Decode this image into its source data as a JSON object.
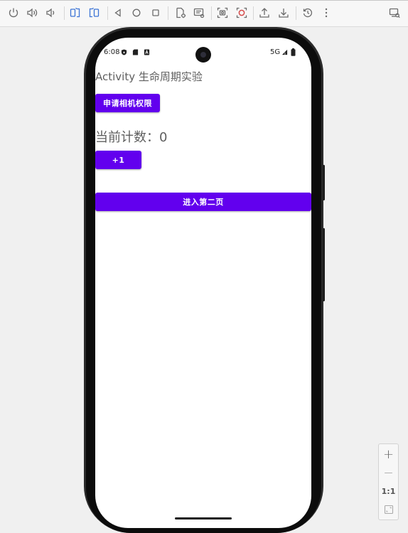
{
  "toolbar": {
    "icons": [
      "power-icon",
      "volume-up-icon",
      "volume-down-icon",
      "rotate-left-icon",
      "rotate-right-icon",
      "back-icon",
      "home-icon",
      "overview-icon",
      "screenshot-settings-icon",
      "screen-record-icon",
      "snapshot-icon",
      "record-icon",
      "export-icon",
      "import-icon",
      "history-icon",
      "more-icon",
      "device-manager-icon"
    ]
  },
  "status_bar": {
    "time": "6:08",
    "network": "5G"
  },
  "app": {
    "title": "Activity 生命周期实验",
    "request_camera_label": "申请相机权限",
    "counter_text": "当前计数：0",
    "increment_label": "+1",
    "next_page_label": "进入第二页"
  },
  "zoom_panel": {
    "zoom_in": "+",
    "zoom_out": "—",
    "actual_size": "1:1"
  },
  "colors": {
    "button_primary": "#6200ee",
    "toolbar_icon": "#6b6b6b",
    "toolbar_icon_active": "#3d74d6",
    "record_red": "#d64a4a"
  }
}
